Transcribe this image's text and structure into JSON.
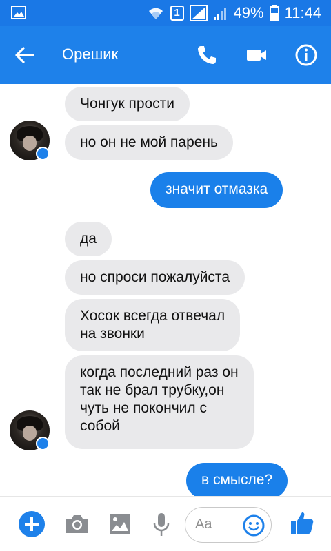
{
  "status_bar": {
    "sim_number": "1",
    "battery": "49%",
    "time": "11:44"
  },
  "header": {
    "title": "Орешик"
  },
  "messages": [
    {
      "side": "in",
      "text": "Чонгук прости"
    },
    {
      "side": "in",
      "text": "но он не мой парень"
    },
    {
      "side": "out",
      "text": "значит отмазка"
    },
    {
      "side": "in",
      "text": "да"
    },
    {
      "side": "in",
      "text": "но спроси пожалуйста"
    },
    {
      "side": "in",
      "line1": "Хосок всегда отвечал",
      "line2": "на звонки"
    },
    {
      "side": "in",
      "line1": "когда последний раз он",
      "line2": "так не брал трубку,он",
      "line3": "чуть не покончил с",
      "line4": "собой"
    },
    {
      "side": "out",
      "text": "в смысле?"
    }
  ],
  "composer": {
    "placeholder": "Aa"
  },
  "colors": {
    "accent": "#1e81ea",
    "status_bar": "#1a78e6",
    "incoming_bubble": "#e9e9eb",
    "outgoing_bubble": "#1a80ea",
    "icon_gray": "#8a8d91"
  },
  "icons": {
    "status_left": "image-icon",
    "signal": "wifi-icon",
    "header_call": "phone-icon",
    "header_video": "video-camera-icon",
    "header_info": "info-icon",
    "composer_add": "plus-icon",
    "composer_camera": "camera-icon",
    "composer_gallery": "gallery-icon",
    "composer_mic": "microphone-icon",
    "composer_emoji": "emoji-icon",
    "composer_like": "thumbs-up-icon"
  }
}
